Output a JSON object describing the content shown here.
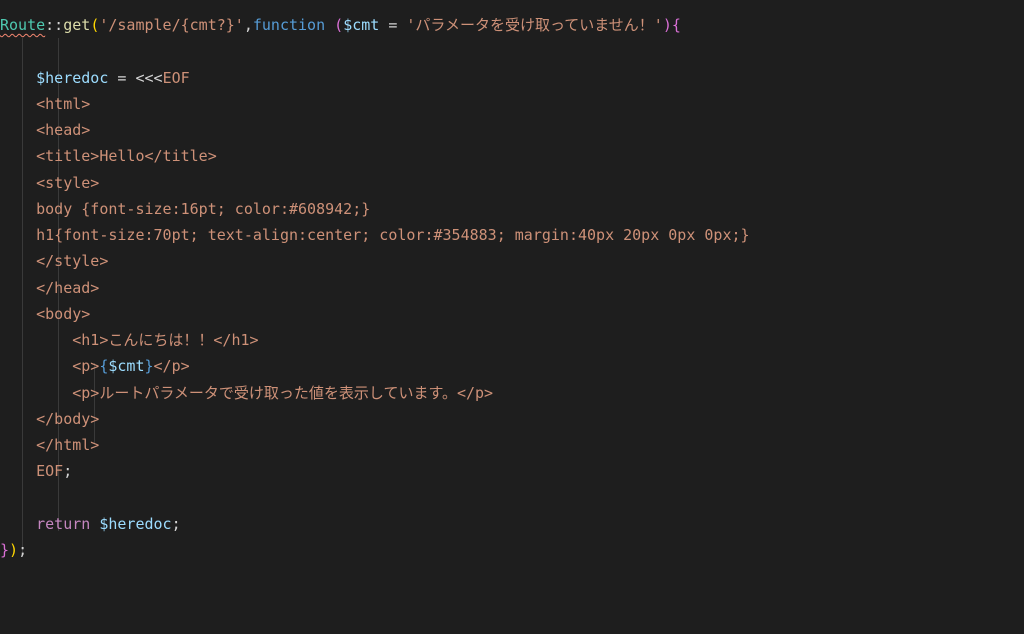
{
  "code": {
    "l1": {
      "route": "Route",
      "scope": "::",
      "method": "get",
      "p1": "(",
      "str1": "'/sample/{cmt?}'",
      "comma": ",",
      "func": "function ",
      "p2": "(",
      "var1": "$cmt",
      "eq": " = ",
      "str2": "'パラメータを受け取っていません！'",
      "p3": ")",
      "b1": "{"
    },
    "l2": "",
    "l3": {
      "pad": "    ",
      "var": "$heredoc",
      "eq": " = <<<",
      "eof": "EOF"
    },
    "l4": {
      "pad": "    ",
      "tag": "<html>"
    },
    "l5": {
      "pad": "    ",
      "tag": "<head>"
    },
    "l6": {
      "pad": "    ",
      "t1": "<title>",
      "txt": "Hello",
      "t2": "</title>"
    },
    "l7": {
      "pad": "    ",
      "tag": "<style>"
    },
    "l8": {
      "pad": "    ",
      "txt": "body {font-size:16pt; color:#608942;}"
    },
    "l9": {
      "pad": "    ",
      "txt": "h1{font-size:70pt; text-align:center; color:#354883; margin:40px 20px 0px 0px;}"
    },
    "l10": {
      "pad": "    ",
      "tag": "</style>"
    },
    "l11": {
      "pad": "    ",
      "tag": "</head>"
    },
    "l12": {
      "pad": "    ",
      "tag": "<body>"
    },
    "l13": {
      "pad": "        ",
      "t1": "<h1>",
      "txt": "こんにちは！！",
      "t2": "</h1>"
    },
    "l14": {
      "pad": "        ",
      "t1": "<p>",
      "b1": "{",
      "var": "$cmt",
      "b2": "}",
      "t2": "</p>"
    },
    "l15": {
      "pad": "        ",
      "t1": "<p>",
      "txt": "ルートパラメータで受け取った値を表示しています。",
      "t2": "</p>"
    },
    "l16": {
      "pad": "    ",
      "tag": "</body>"
    },
    "l17": {
      "pad": "    ",
      "tag": "</html>"
    },
    "l18": {
      "pad": "    ",
      "eof": "EOF",
      "semi": ";"
    },
    "l19": "",
    "l20": {
      "pad": "    ",
      "ret": "return ",
      "var": "$heredoc",
      "semi": ";"
    },
    "l21": {
      "b1": "}",
      "p1": ")",
      "semi": ";"
    }
  }
}
